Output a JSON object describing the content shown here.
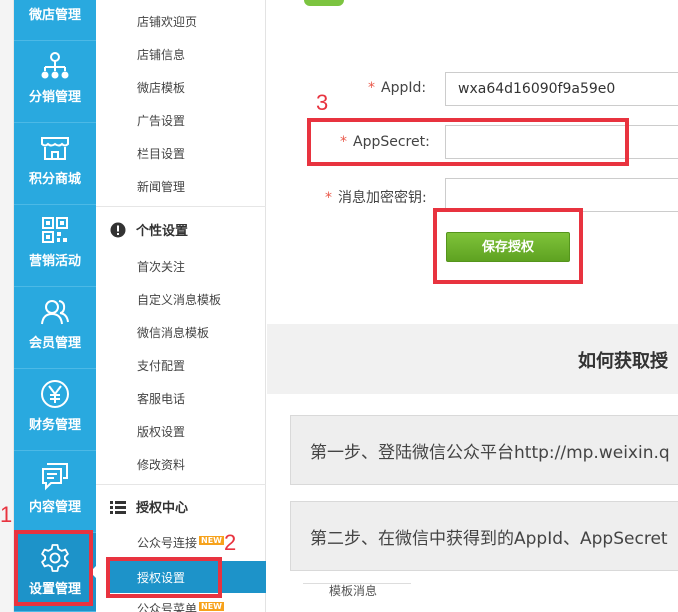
{
  "nav": {
    "items": [
      {
        "label": "微店管理",
        "icon": "store-icon"
      },
      {
        "label": "分销管理",
        "icon": "distribution-tree-icon"
      },
      {
        "label": "积分商城",
        "icon": "shop-awning-icon"
      },
      {
        "label": "营销活动",
        "icon": "qr-code-icon"
      },
      {
        "label": "会员管理",
        "icon": "members-icon"
      },
      {
        "label": "财务管理",
        "icon": "yen-icon"
      },
      {
        "label": "内容管理",
        "icon": "chat-bubbles-icon"
      },
      {
        "label": "设置管理",
        "icon": "gear-icon"
      }
    ],
    "active": "设置管理"
  },
  "submenu": {
    "store_items": [
      "店铺欢迎页",
      "店铺信息",
      "微店模板",
      "广告设置",
      "栏目设置",
      "新闻管理"
    ],
    "personal_head": "个性设置",
    "personal_items": [
      "首次关注",
      "自定义消息模板",
      "微信消息模板",
      "支付配置",
      "客服电话",
      "版权设置",
      "修改资料"
    ],
    "auth_head": "授权中心",
    "auth_items": {
      "public_account": "公众号连接",
      "public_account_badge": "NEW",
      "auth_settings": "授权设置",
      "public_menu": "公众号菜单",
      "public_menu_badge": "NEW"
    }
  },
  "form": {
    "appid_label": "AppId:",
    "appid_value": "wxa64d16090f9a59e0",
    "appsecret_label": "AppSecret:",
    "appsecret_value": "",
    "aeskey_label": "消息加密密钥:",
    "aeskey_value": "",
    "required_mark": "*",
    "save_button": "保存授权"
  },
  "guide": {
    "title": "如何获取授",
    "step1": "第一步、登陆微信公众平台http://mp.weixin.q",
    "step2": "第二步、在微信中获得到的AppId、AppSecret",
    "partial_row": "模板消息"
  },
  "annotations": {
    "n1": "1",
    "n2": "2",
    "n3": "3",
    "color": "#e8333f"
  },
  "colors": {
    "nav_bg": "#29a9df",
    "nav_active": "#1d93c9",
    "save_button": "#6cb22c",
    "required": "#e9584a"
  }
}
